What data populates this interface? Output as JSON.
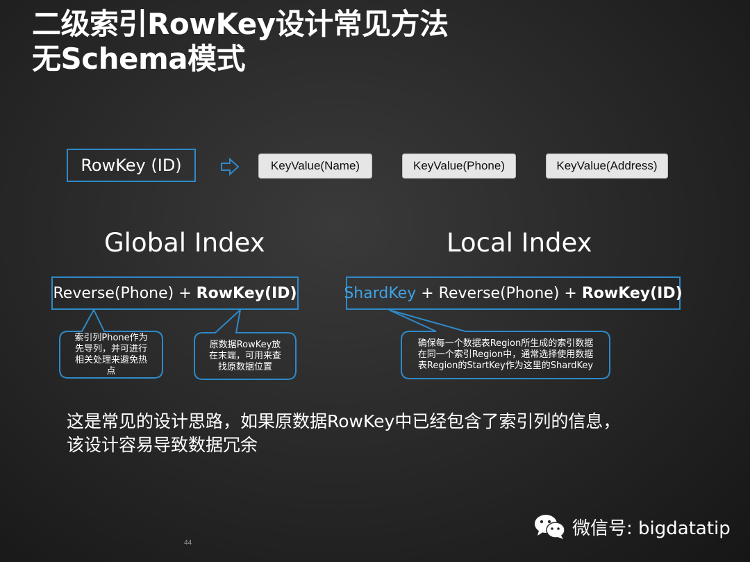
{
  "title": {
    "line1": "二级索引RowKey设计常见方法",
    "line2": "无Schema模式"
  },
  "top_row": {
    "rowkey": "RowKey (ID)",
    "key_values": [
      "KeyValue(Name)",
      "KeyValue(Phone)",
      "KeyValue(Address)"
    ]
  },
  "global_index": {
    "heading": "Global Index",
    "formula_prefix": "Reverse(Phone) + ",
    "formula_bold": "RowKey(ID)",
    "callout_left": [
      "索引列Phone作为",
      "先导列，并可进行",
      "相关处理来避免热",
      "点"
    ],
    "callout_right": [
      "原数据RowKey放",
      "在末端，可用来查",
      "找原数据位置"
    ]
  },
  "local_index": {
    "heading": "Local Index",
    "formula_shard": "ShardKey",
    "formula_middle": " + Reverse(Phone) + ",
    "formula_bold": "RowKey(ID)",
    "callout": [
      "确保每一个数据表Region所生成的索引数据",
      "在同一个索引Region中，通常选择使用数据",
      "表Region的StartKey作为这里的ShardKey"
    ]
  },
  "note": {
    "line1": "这是常见的设计思路，如果原数据RowKey中已经包含了索引列的信息，",
    "line2": "该设计容易导致数据冗余"
  },
  "page_number": "44",
  "wechat": {
    "label": "微信号: bigdatatip",
    "icon": "wechat-icon"
  },
  "colors": {
    "accent": "#2e8ac9",
    "shardkey": "#3fa3e6",
    "kv_fill": "#e6e6e6"
  }
}
